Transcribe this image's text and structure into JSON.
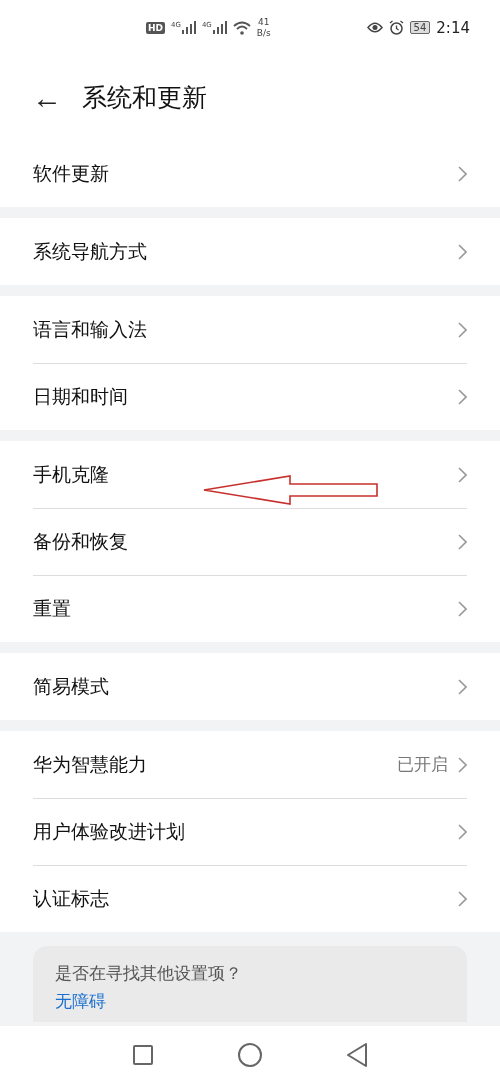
{
  "status_bar": {
    "hd": "HD",
    "networks": [
      "4G",
      "4G"
    ],
    "speed": "41",
    "speed_unit": "B/s",
    "battery": "54",
    "time": "2:14"
  },
  "header": {
    "back": "←",
    "title": "系统和更新"
  },
  "groups": [
    [
      {
        "label": "软件更新"
      }
    ],
    [
      {
        "label": "系统导航方式"
      }
    ],
    [
      {
        "label": "语言和输入法"
      },
      {
        "label": "日期和时间"
      }
    ],
    [
      {
        "label": "手机克隆"
      },
      {
        "label": "备份和恢复"
      },
      {
        "label": "重置"
      }
    ],
    [
      {
        "label": "简易模式"
      }
    ],
    [
      {
        "label": "华为智慧能力",
        "value": "已开启"
      },
      {
        "label": "用户体验改进计划"
      },
      {
        "label": "认证标志"
      }
    ]
  ],
  "suggestion": {
    "question": "是否在寻找其他设置项？",
    "link": "无障碍"
  }
}
